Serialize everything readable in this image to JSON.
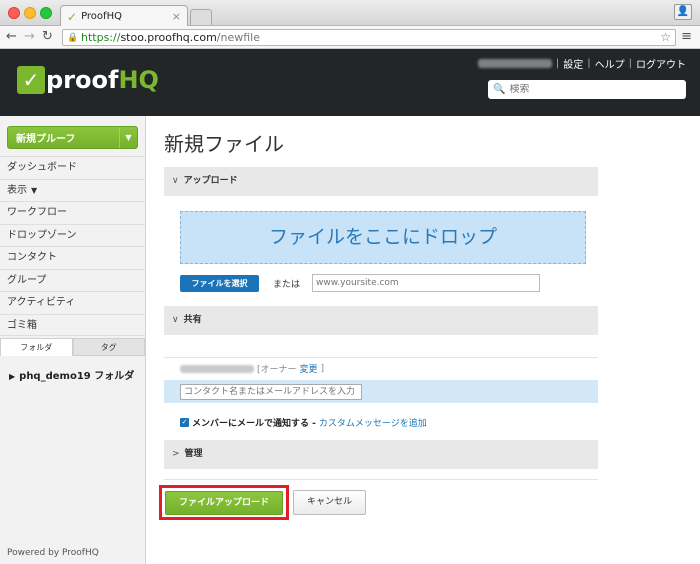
{
  "browser": {
    "tab_title": "ProofHQ",
    "url_scheme": "https://",
    "url_host": "stoo.proofhq.com",
    "url_path": "/newfile"
  },
  "header": {
    "logo_proof": "proof",
    "logo_hq": "HQ",
    "links": [
      "設定",
      "ヘルプ",
      "ログアウト"
    ],
    "search_placeholder": "検索"
  },
  "sidebar": {
    "new_proof_label": "新規プルーフ",
    "items": [
      "ダッシュボード",
      "表示",
      "ワークフロー",
      "ドロップゾーン",
      "コンタクト",
      "グループ",
      "アクティビティ",
      "ゴミ箱"
    ],
    "sub_tabs": [
      "フォルダ",
      "タグ"
    ],
    "folder": "phq_demo19 フォルダ",
    "powered_by": "Powered by ProofHQ"
  },
  "main": {
    "title": "新規ファイル",
    "upload_section": "アップロード",
    "dropzone_text": "ファイルをここにドロップ",
    "choose_file_label": "ファイルを選択",
    "or_label": "または",
    "url_placeholder": "www.yoursite.com",
    "share_section": "共有",
    "owner_open": "[オーナー",
    "owner_change": "変更",
    "owner_close": "]",
    "contact_placeholder": "コンタクト名またはメールアドレスを入力",
    "notify_label": "メンバーにメールで通知する -",
    "custom_message_link": "カスタムメッセージを追加",
    "manage_section": "管理",
    "upload_button": "ファイルアップロード",
    "cancel_button": "キャンセル"
  },
  "colors": {
    "accent_green": "#7cb82f",
    "link_blue": "#1b74b8",
    "header_dark": "#222629",
    "highlight_red": "#e21f26"
  }
}
